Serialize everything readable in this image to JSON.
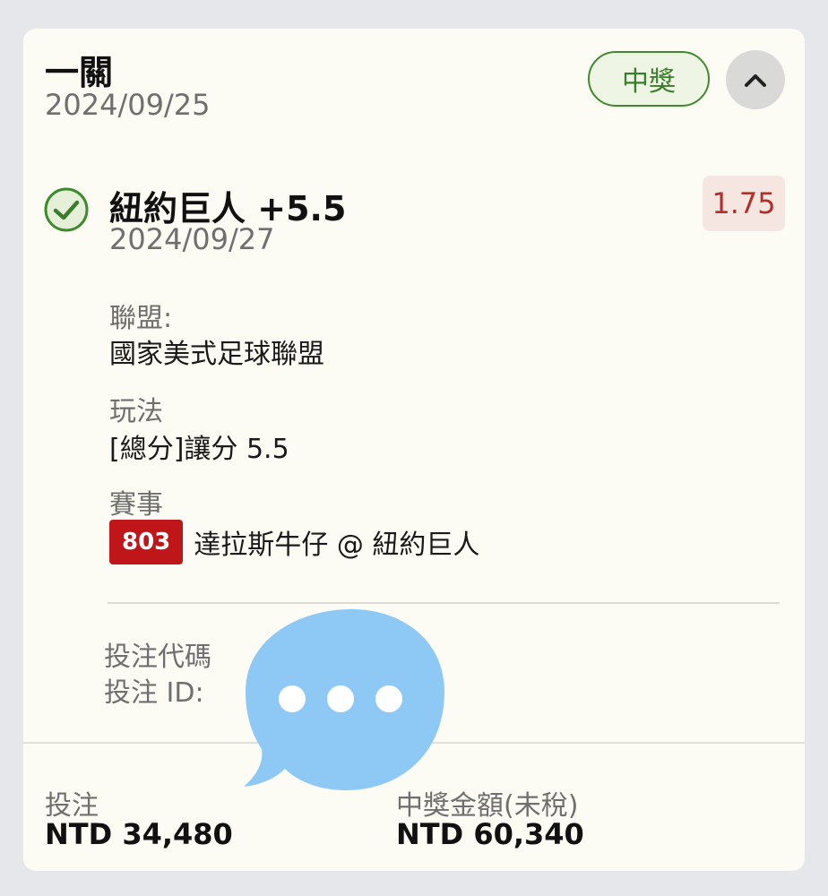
{
  "header": {
    "bet_type": "一關",
    "date": "2024/09/25",
    "status": "中獎"
  },
  "selection": {
    "title": "紐約巨人 +5.5",
    "date": "2024/09/27",
    "odds": "1.75",
    "league_label": "聯盟:",
    "league_value": "國家美式足球聯盟",
    "market_label": "玩法",
    "market_value": "[總分]讓分 5.5",
    "event_label": "賽事",
    "event_number": "803",
    "event_name": "達拉斯牛仔 @ 紐約巨人"
  },
  "meta": {
    "code_label": "投注代碼",
    "id_label": "投注 ID:"
  },
  "footer": {
    "stake_label": "投注",
    "stake_value": "NTD 34,480",
    "payout_label": "中獎金額(未稅)",
    "payout_value": "NTD 60,340"
  },
  "icons": {
    "status_check": "check-circle-icon",
    "collapse": "chevron-up-icon",
    "overlay": "chat-bubble-icon"
  },
  "colors": {
    "win_green": "#3f8a2e",
    "odds_red": "#b0302a",
    "event_badge_red": "#c0161a",
    "overlay_blue": "#8ec9f6"
  }
}
